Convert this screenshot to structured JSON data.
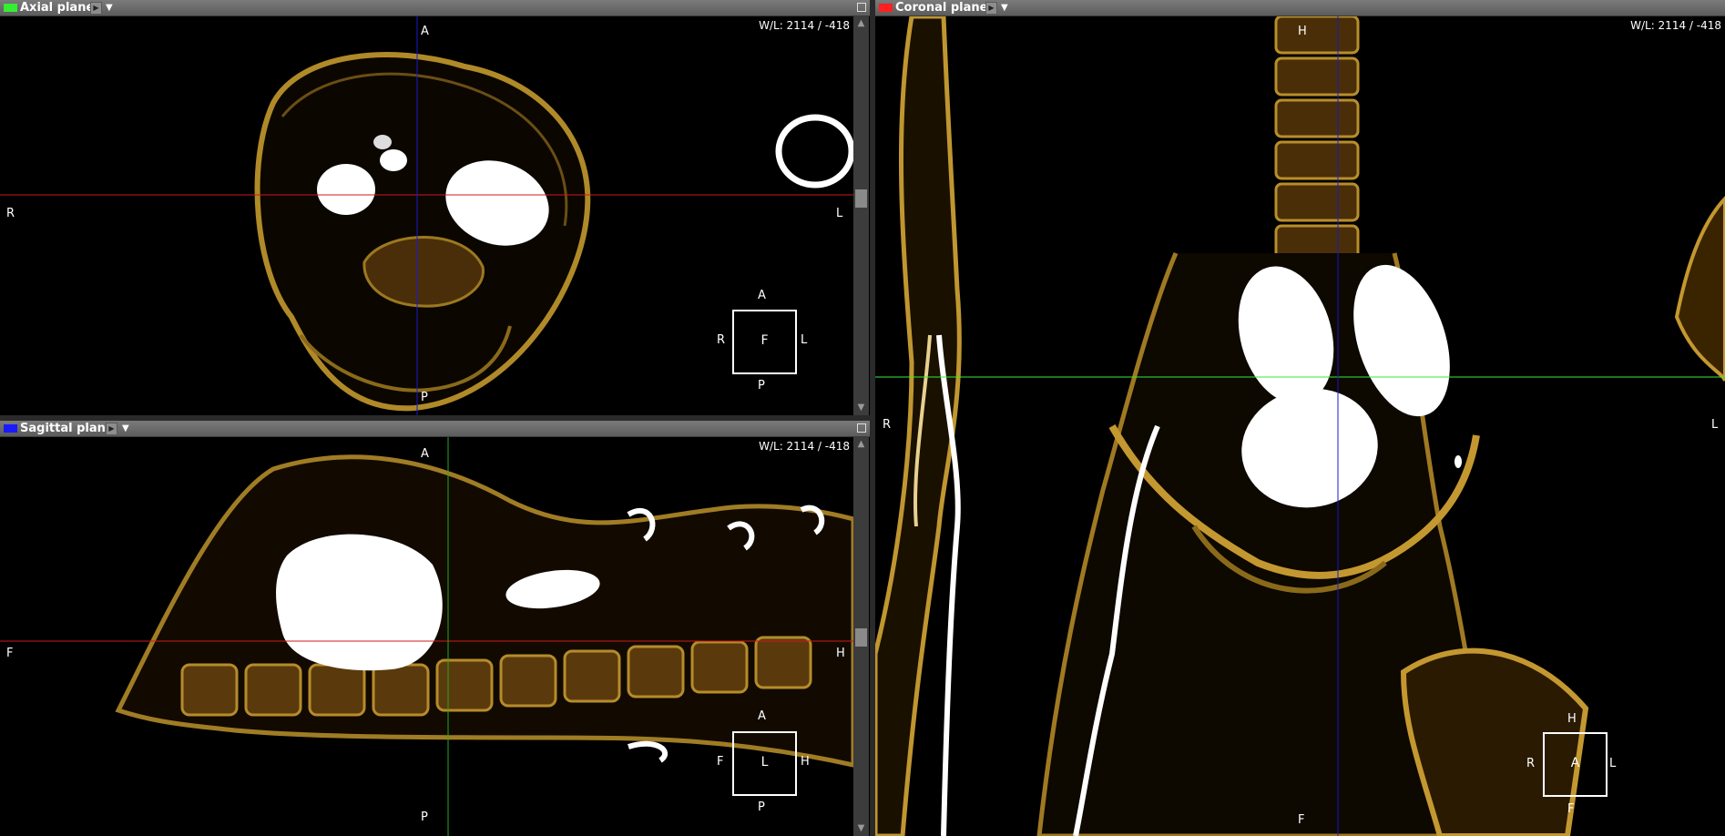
{
  "colors": {
    "axial": "#33ee33",
    "sagittal": "#1a1aff",
    "coronal": "#ff2020",
    "bone": "#c8a030"
  },
  "axial": {
    "title": "Axial plane",
    "wl": "W/L: 2114 / -418",
    "labels": {
      "top": "A",
      "bottom": "P",
      "left": "R",
      "right": "L"
    },
    "cube": {
      "top": "A",
      "bottom": "P",
      "left": "R",
      "right": "L",
      "center": "F"
    }
  },
  "sagittal": {
    "title": "Sagittal plane",
    "wl": "W/L: 2114 / -418",
    "labels": {
      "top": "A",
      "bottom": "P",
      "left": "F",
      "right": "H"
    },
    "cube": {
      "top": "A",
      "bottom": "P",
      "left": "F",
      "right": "H",
      "center": "L"
    }
  },
  "coronal": {
    "title": "Coronal plane",
    "wl": "W/L: 2114 / -418",
    "labels": {
      "top": "H",
      "bottom": "F",
      "left": "R",
      "right": "L"
    },
    "cube": {
      "top": "H",
      "bottom": "F",
      "left": "R",
      "right": "L",
      "center": "A"
    }
  },
  "icons": {
    "play": "play-arrow-icon",
    "menu": "dropdown-triangle-icon",
    "maximize": "maximize-icon"
  }
}
